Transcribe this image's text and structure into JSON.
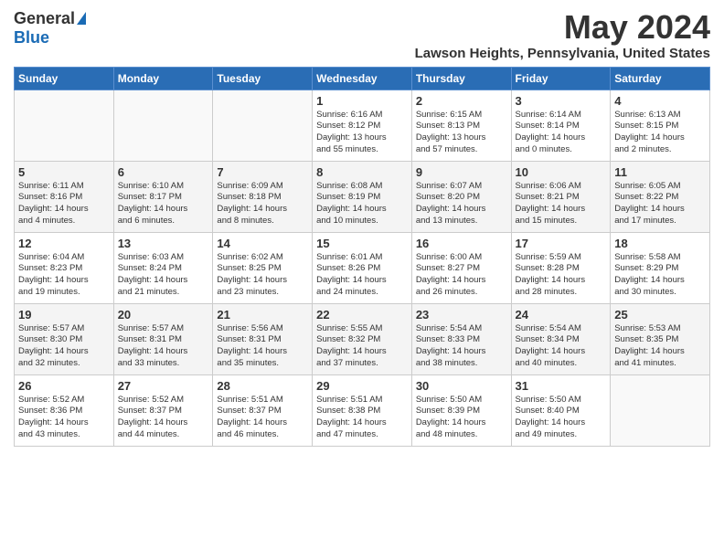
{
  "header": {
    "logo_general": "General",
    "logo_blue": "Blue",
    "month": "May 2024",
    "location": "Lawson Heights, Pennsylvania, United States"
  },
  "days_of_week": [
    "Sunday",
    "Monday",
    "Tuesday",
    "Wednesday",
    "Thursday",
    "Friday",
    "Saturday"
  ],
  "weeks": [
    [
      {
        "day": "",
        "info": ""
      },
      {
        "day": "",
        "info": ""
      },
      {
        "day": "",
        "info": ""
      },
      {
        "day": "1",
        "info": "Sunrise: 6:16 AM\nSunset: 8:12 PM\nDaylight: 13 hours\nand 55 minutes."
      },
      {
        "day": "2",
        "info": "Sunrise: 6:15 AM\nSunset: 8:13 PM\nDaylight: 13 hours\nand 57 minutes."
      },
      {
        "day": "3",
        "info": "Sunrise: 6:14 AM\nSunset: 8:14 PM\nDaylight: 14 hours\nand 0 minutes."
      },
      {
        "day": "4",
        "info": "Sunrise: 6:13 AM\nSunset: 8:15 PM\nDaylight: 14 hours\nand 2 minutes."
      }
    ],
    [
      {
        "day": "5",
        "info": "Sunrise: 6:11 AM\nSunset: 8:16 PM\nDaylight: 14 hours\nand 4 minutes."
      },
      {
        "day": "6",
        "info": "Sunrise: 6:10 AM\nSunset: 8:17 PM\nDaylight: 14 hours\nand 6 minutes."
      },
      {
        "day": "7",
        "info": "Sunrise: 6:09 AM\nSunset: 8:18 PM\nDaylight: 14 hours\nand 8 minutes."
      },
      {
        "day": "8",
        "info": "Sunrise: 6:08 AM\nSunset: 8:19 PM\nDaylight: 14 hours\nand 10 minutes."
      },
      {
        "day": "9",
        "info": "Sunrise: 6:07 AM\nSunset: 8:20 PM\nDaylight: 14 hours\nand 13 minutes."
      },
      {
        "day": "10",
        "info": "Sunrise: 6:06 AM\nSunset: 8:21 PM\nDaylight: 14 hours\nand 15 minutes."
      },
      {
        "day": "11",
        "info": "Sunrise: 6:05 AM\nSunset: 8:22 PM\nDaylight: 14 hours\nand 17 minutes."
      }
    ],
    [
      {
        "day": "12",
        "info": "Sunrise: 6:04 AM\nSunset: 8:23 PM\nDaylight: 14 hours\nand 19 minutes."
      },
      {
        "day": "13",
        "info": "Sunrise: 6:03 AM\nSunset: 8:24 PM\nDaylight: 14 hours\nand 21 minutes."
      },
      {
        "day": "14",
        "info": "Sunrise: 6:02 AM\nSunset: 8:25 PM\nDaylight: 14 hours\nand 23 minutes."
      },
      {
        "day": "15",
        "info": "Sunrise: 6:01 AM\nSunset: 8:26 PM\nDaylight: 14 hours\nand 24 minutes."
      },
      {
        "day": "16",
        "info": "Sunrise: 6:00 AM\nSunset: 8:27 PM\nDaylight: 14 hours\nand 26 minutes."
      },
      {
        "day": "17",
        "info": "Sunrise: 5:59 AM\nSunset: 8:28 PM\nDaylight: 14 hours\nand 28 minutes."
      },
      {
        "day": "18",
        "info": "Sunrise: 5:58 AM\nSunset: 8:29 PM\nDaylight: 14 hours\nand 30 minutes."
      }
    ],
    [
      {
        "day": "19",
        "info": "Sunrise: 5:57 AM\nSunset: 8:30 PM\nDaylight: 14 hours\nand 32 minutes."
      },
      {
        "day": "20",
        "info": "Sunrise: 5:57 AM\nSunset: 8:31 PM\nDaylight: 14 hours\nand 33 minutes."
      },
      {
        "day": "21",
        "info": "Sunrise: 5:56 AM\nSunset: 8:31 PM\nDaylight: 14 hours\nand 35 minutes."
      },
      {
        "day": "22",
        "info": "Sunrise: 5:55 AM\nSunset: 8:32 PM\nDaylight: 14 hours\nand 37 minutes."
      },
      {
        "day": "23",
        "info": "Sunrise: 5:54 AM\nSunset: 8:33 PM\nDaylight: 14 hours\nand 38 minutes."
      },
      {
        "day": "24",
        "info": "Sunrise: 5:54 AM\nSunset: 8:34 PM\nDaylight: 14 hours\nand 40 minutes."
      },
      {
        "day": "25",
        "info": "Sunrise: 5:53 AM\nSunset: 8:35 PM\nDaylight: 14 hours\nand 41 minutes."
      }
    ],
    [
      {
        "day": "26",
        "info": "Sunrise: 5:52 AM\nSunset: 8:36 PM\nDaylight: 14 hours\nand 43 minutes."
      },
      {
        "day": "27",
        "info": "Sunrise: 5:52 AM\nSunset: 8:37 PM\nDaylight: 14 hours\nand 44 minutes."
      },
      {
        "day": "28",
        "info": "Sunrise: 5:51 AM\nSunset: 8:37 PM\nDaylight: 14 hours\nand 46 minutes."
      },
      {
        "day": "29",
        "info": "Sunrise: 5:51 AM\nSunset: 8:38 PM\nDaylight: 14 hours\nand 47 minutes."
      },
      {
        "day": "30",
        "info": "Sunrise: 5:50 AM\nSunset: 8:39 PM\nDaylight: 14 hours\nand 48 minutes."
      },
      {
        "day": "31",
        "info": "Sunrise: 5:50 AM\nSunset: 8:40 PM\nDaylight: 14 hours\nand 49 minutes."
      },
      {
        "day": "",
        "info": ""
      }
    ]
  ]
}
